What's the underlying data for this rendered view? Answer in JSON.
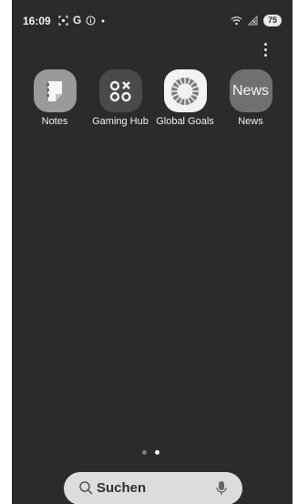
{
  "status_bar": {
    "time": "16:09",
    "icons": [
      "screenshot-icon",
      "google-icon",
      "info-icon",
      "dot-icon"
    ],
    "google_letter": "G",
    "battery": "75"
  },
  "apps": [
    {
      "label": "Notes",
      "icon": "notes-icon"
    },
    {
      "label": "Gaming Hub",
      "icon": "gaming-hub-icon"
    },
    {
      "label": "Global Goals",
      "icon": "global-goals-icon"
    },
    {
      "label": "News",
      "icon": "news-icon",
      "icon_text": "News"
    }
  ],
  "page_indicator": {
    "pages": 2,
    "active": 2
  },
  "search": {
    "label": "Suchen"
  }
}
